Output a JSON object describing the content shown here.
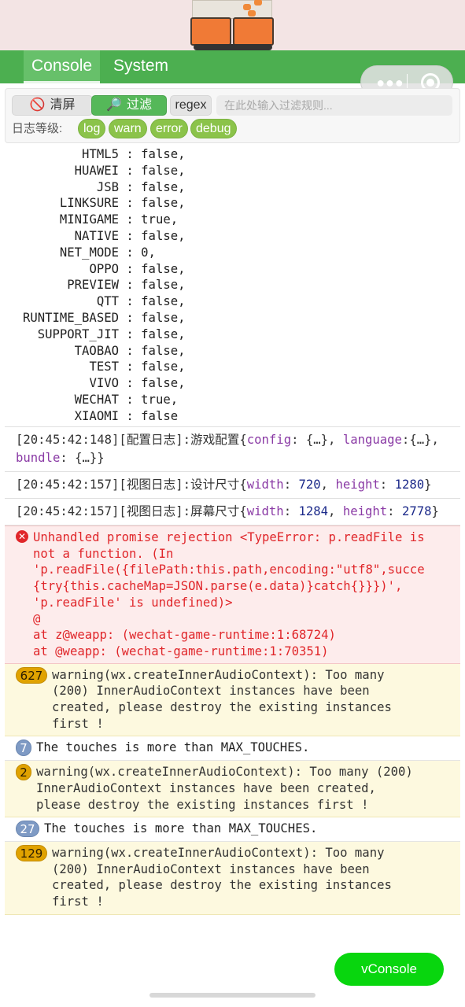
{
  "tabs": [
    {
      "label": "Console",
      "active": true
    },
    {
      "label": "System",
      "active": false
    }
  ],
  "toolbar": {
    "clear_label": "清屏",
    "filter_label": "过滤",
    "regex_label": "regex",
    "filter_placeholder": "在此处输入过滤规则...",
    "level_label": "日志等级:",
    "levels": [
      "log",
      "warn",
      "error",
      "debug"
    ]
  },
  "config_lines": [
    {
      "key": "HTML5",
      "value": "false,"
    },
    {
      "key": "HUAWEI",
      "value": "false,"
    },
    {
      "key": "JSB",
      "value": "false,"
    },
    {
      "key": "LINKSURE",
      "value": "false,"
    },
    {
      "key": "MINIGAME",
      "value": "true,"
    },
    {
      "key": "NATIVE",
      "value": "false,"
    },
    {
      "key": "NET_MODE",
      "value": "0,"
    },
    {
      "key": "OPPO",
      "value": "false,"
    },
    {
      "key": "PREVIEW",
      "value": "false,"
    },
    {
      "key": "QTT",
      "value": "false,"
    },
    {
      "key": "RUNTIME_BASED",
      "value": "false,"
    },
    {
      "key": "SUPPORT_JIT",
      "value": "false,"
    },
    {
      "key": "TAOBAO",
      "value": "false,"
    },
    {
      "key": "TEST",
      "value": "false,"
    },
    {
      "key": "VIVO",
      "value": "false,"
    },
    {
      "key": "WECHAT",
      "value": "true,"
    },
    {
      "key": "XIAOMI",
      "value": "false"
    }
  ],
  "entries": {
    "config_log": {
      "prefix": "[20:45:42:148][配置日志]:游戏配置{",
      "k1": "config",
      "v1": ": {…}, ",
      "k2": "language",
      "v2": ":",
      "tail1": "{…}, ",
      "k3": "bundle",
      "tail2": ": {…}}"
    },
    "design_size": {
      "prefix": "[20:45:42:157][视图日志]:设计尺寸{",
      "k1": "width",
      "n1": "720",
      "k2": "height",
      "n2": "1280",
      "close": "}"
    },
    "screen_size": {
      "prefix": "[20:45:42:157][视图日志]:屏幕尺寸{",
      "k1": "width",
      "n1": "1284",
      "k2": "height",
      "n2": "2778",
      "close": "}"
    }
  },
  "error": {
    "icon": "error-x-icon",
    "lines": [
      "Unhandled promise rejection <TypeError: p.readFile is",
      "not a function. (In",
      "'p.readFile({filePath:this.path,encoding:\"utf8\",succe",
      "{try{this.cacheMap=JSON.parse(e.data)}catch{}}})',",
      "'p.readFile' is undefined)>",
      "@",
      "at z@weapp: (wechat-game-runtime:1:68724)",
      "at @weapp: (wechat-game-runtime:1:70351)"
    ]
  },
  "repeats": [
    {
      "count": "627",
      "color": "orange",
      "lines": [
        "warning(wx.createInnerAudioContext): Too many",
        "(200) InnerAudioContext instances have been",
        "created, please destroy the existing instances",
        "first !"
      ]
    },
    {
      "count": "7",
      "color": "blue",
      "lines": [
        "The touches is more than MAX_TOUCHES."
      ]
    },
    {
      "count": "2",
      "color": "orange",
      "lines": [
        "warning(wx.createInnerAudioContext): Too many (200)",
        "InnerAudioContext instances have been created,",
        "please destroy the existing instances first !"
      ]
    },
    {
      "count": "27",
      "color": "blue",
      "lines": [
        "The touches is more than MAX_TOUCHES."
      ]
    },
    {
      "count": "129",
      "color": "orange",
      "lines": [
        "warning(wx.createInnerAudioContext): Too many",
        "(200) InnerAudioContext instances have been",
        "created, please destroy the existing instances",
        "first !"
      ]
    }
  ],
  "vconsole_label": "vConsole",
  "colors": {
    "tabbar": "#4caf50",
    "vconsole": "#08d60e",
    "error_text": "#e0262a",
    "warn_bg": "#fdf9df"
  }
}
